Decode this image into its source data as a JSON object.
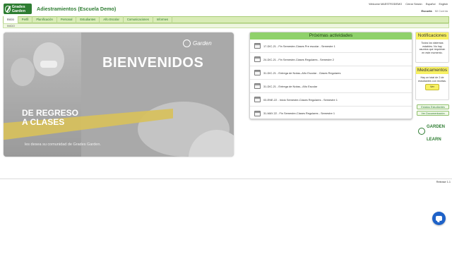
{
  "header": {
    "logo_text": "Grades Garden",
    "title": "Adiestramientos (Escuela Demo)",
    "welcome": "Welcome MAESTRODEMO",
    "logout": "Cerrar Sesión",
    "lang_es": "Español",
    "lang_en": "English",
    "school_label": "Escuela",
    "school_value": "Mi Cuenta"
  },
  "nav": {
    "items": [
      {
        "label": "Inicio"
      },
      {
        "label": "Perfil"
      },
      {
        "label": "Planificación"
      },
      {
        "label": "Personal"
      },
      {
        "label": "Estudiantes"
      },
      {
        "label": "Año Escolar"
      },
      {
        "label": "Comunicaciones"
      },
      {
        "label": "Informes"
      }
    ],
    "breadcrumb": "INICIO"
  },
  "banner": {
    "brand": "Garden",
    "headline": "BIENVENIDOS",
    "subtitle_line1": "DE REGRESO",
    "subtitle_line2": "A CLASES",
    "tagline": "les desea su comunidad de Grades Garden."
  },
  "activities": {
    "title": "Próximas actividades",
    "items": [
      {
        "text": "17-DIC-21 - Fin Semestre-Clases Pre escolar - Semestre 1"
      },
      {
        "text": "24-DIC-21 - Fin Semestre-Clases Regulares - Semestre 2"
      },
      {
        "text": "31-DIC-21 - Entrega de Notas--Año Escolar - Clases Regulares"
      },
      {
        "text": "31-DIC-21 - Entrega de Notas-- Año Escolar"
      },
      {
        "text": "03-ENE-22 - Inicio Semestre-Clases Regulares - Semestre 1"
      },
      {
        "text": "31-MAY-22 - Fin Semestre-Clases Regulares - Semestre 1"
      }
    ]
  },
  "notifications": {
    "title": "Notificaciones",
    "body": "Todos los sistemas estables. No hay asuntos que requieran en este momento."
  },
  "medications": {
    "title": "Medicamentos",
    "body": "Hay un total de 2 de estudiantes con recetas.",
    "button": "Ver"
  },
  "side_links": {
    "students": "Estatus Estudiantes",
    "docs": "Ver Documentación"
  },
  "footer_logo": {
    "line1": "GARDEN",
    "line2": "LEARN"
  },
  "version": "Release 1.1",
  "colors": {
    "accent": "#2e7d32",
    "nav_bg": "#d9ecb6",
    "activity_header": "#8fd16b",
    "notice_header": "#f7f062",
    "chat": "#1e62c8"
  },
  "icons": {
    "chat": "chat-icon",
    "calendar": "calendar-icon",
    "globe": "globe-icon"
  }
}
